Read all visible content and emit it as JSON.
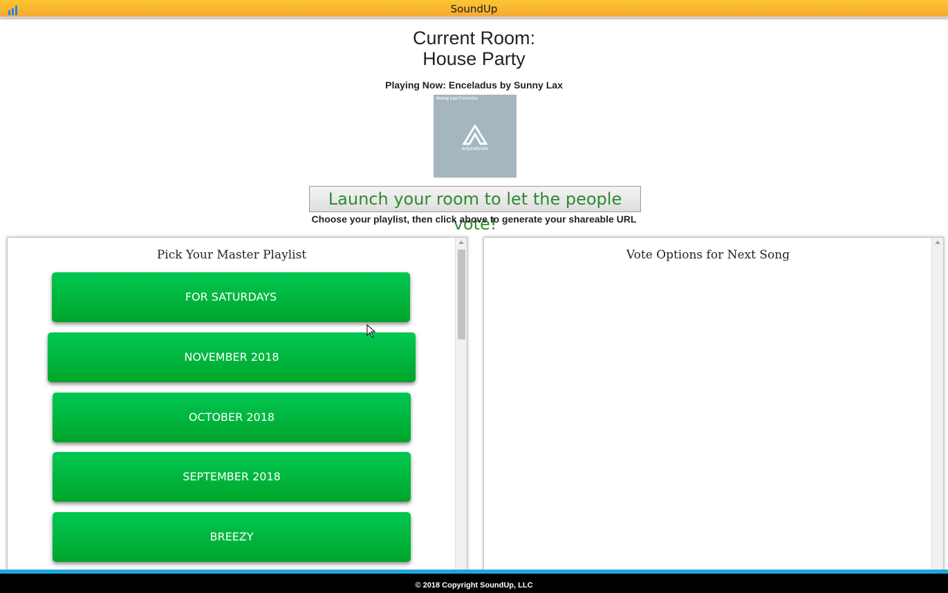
{
  "header": {
    "app_title": "SoundUp",
    "logo_icon": "bar-chart-icon"
  },
  "room": {
    "label": "Current Room:",
    "name": "House Party"
  },
  "now_playing": {
    "text": "Playing Now: Enceladus by Sunny Lax",
    "album_artist": "Sunny Lax",
    "album_title": "Enceladus",
    "album_brand": "anjunabeats"
  },
  "launch_button": "Launch your room to let the people vote!",
  "hint": "Choose your playlist, then click above to generate your shareable URL",
  "playlist_panel": {
    "title": "Pick Your Master Playlist",
    "items": [
      "FOR SATURDAYS",
      "NOVEMBER 2018",
      "OCTOBER 2018",
      "SEPTEMBER 2018",
      "BREEZY"
    ]
  },
  "vote_panel": {
    "title": "Vote Options for Next Song"
  },
  "footer": {
    "copyright": "© 2018 Copyright SoundUp, LLC"
  },
  "colors": {
    "accent_green": "#00b33c",
    "header_orange": "#f8b532",
    "footer_blue": "#22a6d9"
  }
}
